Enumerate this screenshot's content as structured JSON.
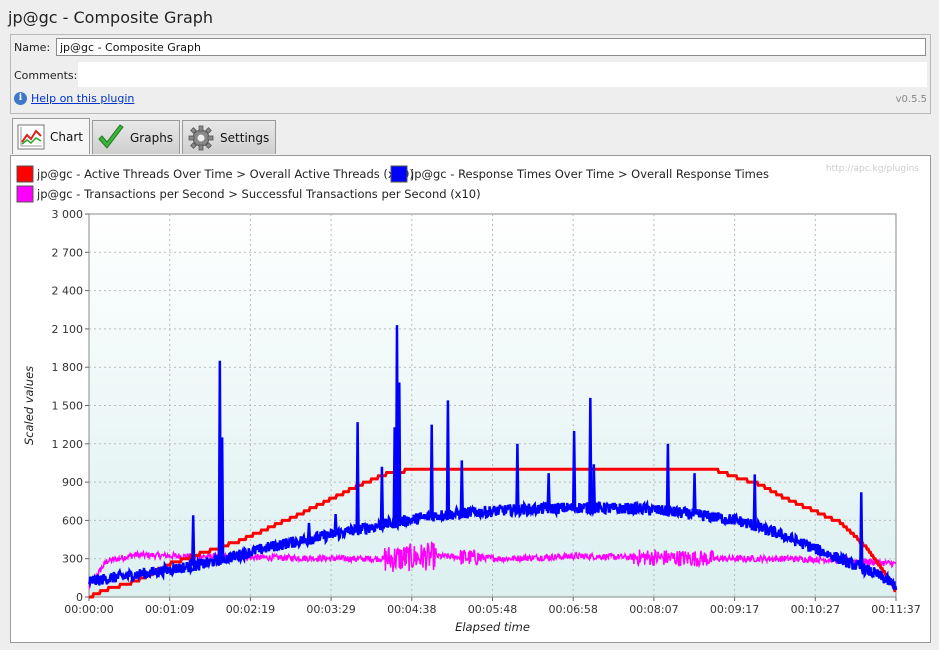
{
  "window": {
    "title": "jp@gc - Composite Graph"
  },
  "form": {
    "name_label": "Name:",
    "name_value": "jp@gc - Composite Graph",
    "comments_label": "Comments:",
    "help_link": "Help on this plugin",
    "version": "v0.5.5"
  },
  "tabs": [
    {
      "label": "Chart",
      "icon": "chart-icon",
      "active": true
    },
    {
      "label": "Graphs",
      "icon": "checkmark-icon",
      "active": false
    },
    {
      "label": "Settings",
      "icon": "gear-icon",
      "active": false
    }
  ],
  "chart_data": {
    "type": "line",
    "watermark": "http://apc.kg/plugins",
    "legend": [
      {
        "name": "jp@gc - Active Threads Over Time > Overall Active Threads (x10)",
        "color": "#ff0000"
      },
      {
        "name": "jp@gc - Response Times Over Time > Overall Response Times",
        "color": "#0000ff"
      },
      {
        "name": "jp@gc - Transactions per Second > Successful Transactions per Second (x10)",
        "color": "#ff00ff"
      }
    ],
    "legend_placement": "top",
    "xlabel": "Elapsed time",
    "ylabel": "Scaled values",
    "ylim": [
      0,
      3000
    ],
    "xlim_seconds": [
      0,
      697
    ],
    "yticks": [
      "0",
      "300",
      "600",
      "900",
      "1 200",
      "1 500",
      "1 800",
      "2 100",
      "2 400",
      "2 700",
      "3 000"
    ],
    "xticks": [
      "00:00:00",
      "00:01:09",
      "00:02:19",
      "00:03:29",
      "00:04:38",
      "00:05:48",
      "00:06:58",
      "00:08:07",
      "00:09:17",
      "00:10:27",
      "00:11:37"
    ],
    "grid": true,
    "series": [
      {
        "name": "jp@gc - Active Threads Over Time > Overall Active Threads (x10)",
        "color": "#ff0000",
        "x": [
          0,
          15,
          40,
          70,
          100,
          130,
          155,
          180,
          205,
          230,
          255,
          280,
          310,
          330,
          400,
          480,
          540,
          555,
          580,
          600,
          620,
          650,
          670,
          690,
          697
        ],
        "y": [
          0,
          60,
          120,
          260,
          350,
          440,
          540,
          640,
          750,
          860,
          960,
          1000,
          1000,
          1000,
          1000,
          1000,
          1000,
          950,
          880,
          780,
          700,
          580,
          400,
          160,
          40
        ]
      },
      {
        "name": "jp@gc - Response Times Over Time > Overall Response Times",
        "color": "#0000ff",
        "x": [
          0,
          20,
          60,
          100,
          130,
          160,
          200,
          250,
          300,
          360,
          420,
          480,
          520,
          560,
          600,
          640,
          680,
          697
        ],
        "y": [
          120,
          150,
          200,
          260,
          330,
          400,
          470,
          560,
          640,
          680,
          700,
          690,
          650,
          600,
          480,
          330,
          180,
          90
        ],
        "spikes": [
          {
            "x": 90,
            "y": 640
          },
          {
            "x": 113,
            "y": 1850
          },
          {
            "x": 115,
            "y": 1250
          },
          {
            "x": 190,
            "y": 580
          },
          {
            "x": 213,
            "y": 650
          },
          {
            "x": 232,
            "y": 1370
          },
          {
            "x": 253,
            "y": 1020
          },
          {
            "x": 264,
            "y": 1330
          },
          {
            "x": 266,
            "y": 2130
          },
          {
            "x": 268,
            "y": 1680
          },
          {
            "x": 296,
            "y": 1350
          },
          {
            "x": 310,
            "y": 1540
          },
          {
            "x": 322,
            "y": 1070
          },
          {
            "x": 370,
            "y": 1200
          },
          {
            "x": 397,
            "y": 970
          },
          {
            "x": 419,
            "y": 1300
          },
          {
            "x": 433,
            "y": 1560
          },
          {
            "x": 436,
            "y": 1040
          },
          {
            "x": 500,
            "y": 1200
          },
          {
            "x": 523,
            "y": 970
          },
          {
            "x": 575,
            "y": 960
          },
          {
            "x": 667,
            "y": 820
          }
        ]
      },
      {
        "name": "jp@gc - Transactions per Second > Successful Transactions per Second (x10)",
        "color": "#ff00ff",
        "x": [
          0,
          15,
          40,
          80,
          150,
          220,
          260,
          300,
          360,
          420,
          480,
          540,
          600,
          650,
          697
        ],
        "y": [
          80,
          280,
          330,
          320,
          310,
          300,
          300,
          320,
          300,
          320,
          310,
          300,
          300,
          290,
          260
        ]
      }
    ]
  }
}
